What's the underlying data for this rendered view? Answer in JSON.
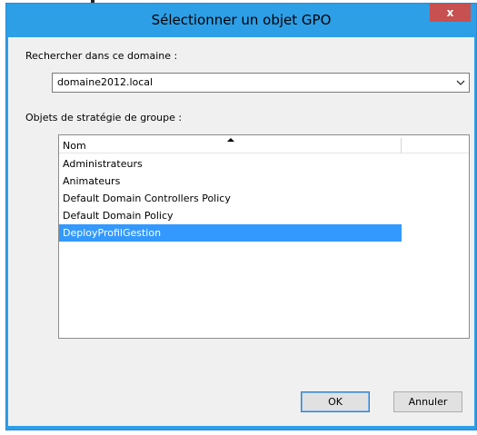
{
  "window": {
    "title": "Sélectionner un objet GPO",
    "close_label": "x"
  },
  "domain": {
    "label": "Rechercher dans ce domaine :",
    "selected": "domaine2012.local"
  },
  "gpo_list": {
    "label": "Objets de stratégie de groupe :",
    "column_header": "Nom",
    "sort": "ascending",
    "items": [
      {
        "name": "Administrateurs",
        "selected": false
      },
      {
        "name": "Animateurs",
        "selected": false
      },
      {
        "name": "Default Domain Controllers Policy",
        "selected": false
      },
      {
        "name": "Default Domain Policy",
        "selected": false
      },
      {
        "name": "DeployProfilGestion",
        "selected": true
      }
    ]
  },
  "buttons": {
    "ok_label": "OK",
    "cancel_label": "Annuler"
  },
  "colors": {
    "titlebar": "#2d9fe6",
    "close_button": "#c75050",
    "selection": "#3399ff"
  }
}
